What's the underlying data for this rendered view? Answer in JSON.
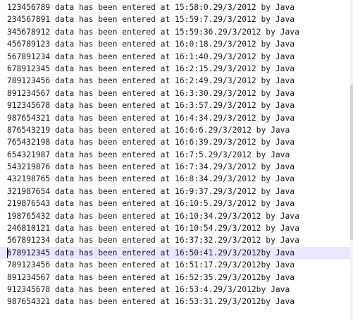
{
  "editor": {
    "current_line_index": 20,
    "lines": [
      "123456789 data has been entered at 15:58:0.29/3/2012 by Java",
      "234567891 data has been entered at 15:59:7.29/3/2012 by Java",
      "345678912 data has been entered at 15:59:36.29/3/2012 by Java",
      "456789123 data has been entered at 16:0:18.29/3/2012 by Java",
      "567891234 data has been entered at 16:1:40.29/3/2012 by Java",
      "678912345 data has been entered at 16:2:15.29/3/2012 by Java",
      "789123456 data has been entered at 16:2:49.29/3/2012 by Java",
      "891234567 data has been entered at 16:3:30.29/3/2012 by Java",
      "912345678 data has been entered at 16:3:57.29/3/2012 by Java",
      "987654321 data has been entered at 16:4:34.29/3/2012 by Java",
      "876543219 data has been entered at 16:6:6.29/3/2012 by Java",
      "765432198 data has been entered at 16:6:39.29/3/2012 by Java",
      "654321987 data has been entered at 16:7:5.29/3/2012 by Java",
      "543219876 data has been entered at 16:7:34.29/3/2012 by Java",
      "432198765 data has been entered at 16:8:34.29/3/2012 by Java",
      "321987654 data has been entered at 16:9:37.29/3/2012 by Java",
      "219876543 data has been entered at 16:10:5.29/3/2012 by Java",
      "198765432 data has been entered at 16:10:34.29/3/2012 by Java",
      "246810121 data has been entered at 16:10:54.29/3/2012 by Java",
      "567891234 data has been entered at 16:37:32.29/3/2012 by Java",
      "678912345 data has been entered at 16:50:41.29/3/2012by Java",
      "789123456 data has been entered at 16:51:17.29/3/2012by Java",
      "891234567 data has been entered at 16:52:35.29/3/2012by Java",
      "912345678 data has been entered at 16:53:4.29/3/2012by Java",
      "987654321 data has been entered at 16:53:31.29/3/2012by Java"
    ]
  }
}
